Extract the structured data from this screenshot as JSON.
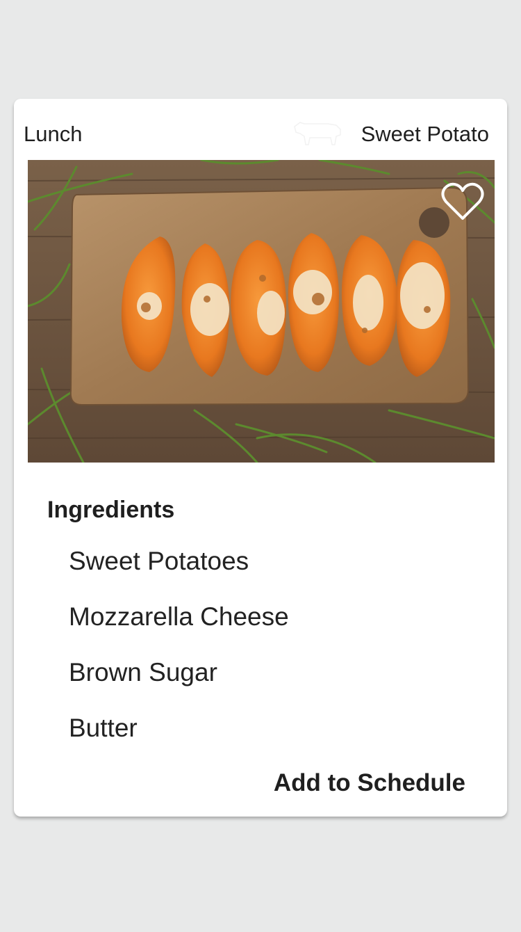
{
  "card": {
    "meal": "Lunch",
    "title": "Sweet Potato",
    "photo_icon": "recipe-photo",
    "favorite_icon": "heart-outline-icon",
    "ingredients_heading": "Ingredients",
    "ingredients": [
      "Sweet Potatoes",
      "Mozzarella Cheese",
      "Brown Sugar",
      "Butter"
    ],
    "action_label": "Add to Schedule"
  },
  "colors": {
    "background": "#e8e9e9",
    "card": "#ffffff",
    "text": "#1f1f1f",
    "potato": "#e8781f",
    "board": "#a88158",
    "table": "#6b5440"
  }
}
